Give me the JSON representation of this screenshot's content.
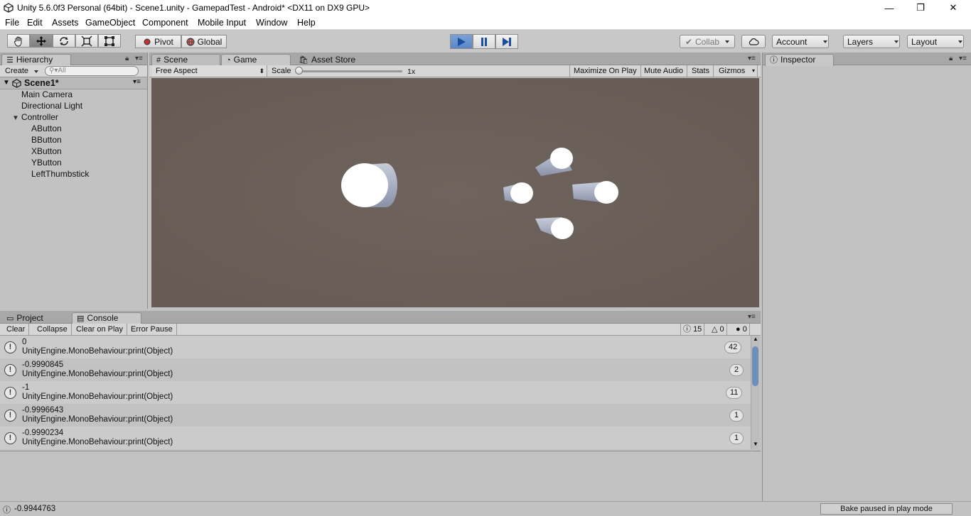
{
  "window": {
    "title": "Unity 5.6.0f3 Personal (64bit) - Scene1.unity - GamepadTest - Android* <DX11 on DX9 GPU>",
    "minimize": "—",
    "maximize": "❐",
    "close": "✕"
  },
  "menu": [
    "File",
    "Edit",
    "Assets",
    "GameObject",
    "Component",
    "Mobile Input",
    "Window",
    "Help"
  ],
  "toolbar": {
    "pivot": "Pivot",
    "global": "Global",
    "collab": "Collab",
    "account": "Account",
    "layers": "Layers",
    "layout": "Layout"
  },
  "hierarchy": {
    "tab": "Hierarchy",
    "create": "Create",
    "search_placeholder": "All",
    "scene": "Scene1*",
    "items": [
      "Main Camera",
      "Directional Light",
      "Controller",
      "AButton",
      "BButton",
      "XButton",
      "YButton",
      "LeftThumbstick"
    ]
  },
  "center_tabs": [
    "Scene",
    "Game",
    "Asset Store"
  ],
  "game": {
    "aspect": "Free Aspect",
    "scale_label": "Scale",
    "scale_value": "1x",
    "maximize": "Maximize On Play",
    "mute": "Mute Audio",
    "stats": "Stats",
    "gizmos": "Gizmos"
  },
  "inspector": {
    "tab": "Inspector"
  },
  "bottom_tabs": [
    "Project",
    "Console"
  ],
  "console": {
    "clear": "Clear",
    "collapse": "Collapse",
    "clear_on_play": "Clear on Play",
    "error_pause": "Error Pause",
    "count_info": "15",
    "count_warn": "0",
    "count_error": "0",
    "entries": [
      {
        "value": "0",
        "source": "UnityEngine.MonoBehaviour:print(Object)",
        "count": "42"
      },
      {
        "value": "-0.9990845",
        "source": "UnityEngine.MonoBehaviour:print(Object)",
        "count": "2"
      },
      {
        "value": "-1",
        "source": "UnityEngine.MonoBehaviour:print(Object)",
        "count": "11"
      },
      {
        "value": "-0.9996643",
        "source": "UnityEngine.MonoBehaviour:print(Object)",
        "count": "1"
      },
      {
        "value": "-0.9990234",
        "source": "UnityEngine.MonoBehaviour:print(Object)",
        "count": "1"
      }
    ]
  },
  "status": {
    "last_log": "-0.9944763",
    "bake": "Bake paused in play mode"
  },
  "colors": {
    "game_bg": "#6b6059",
    "play_active": "#5a86c8"
  }
}
